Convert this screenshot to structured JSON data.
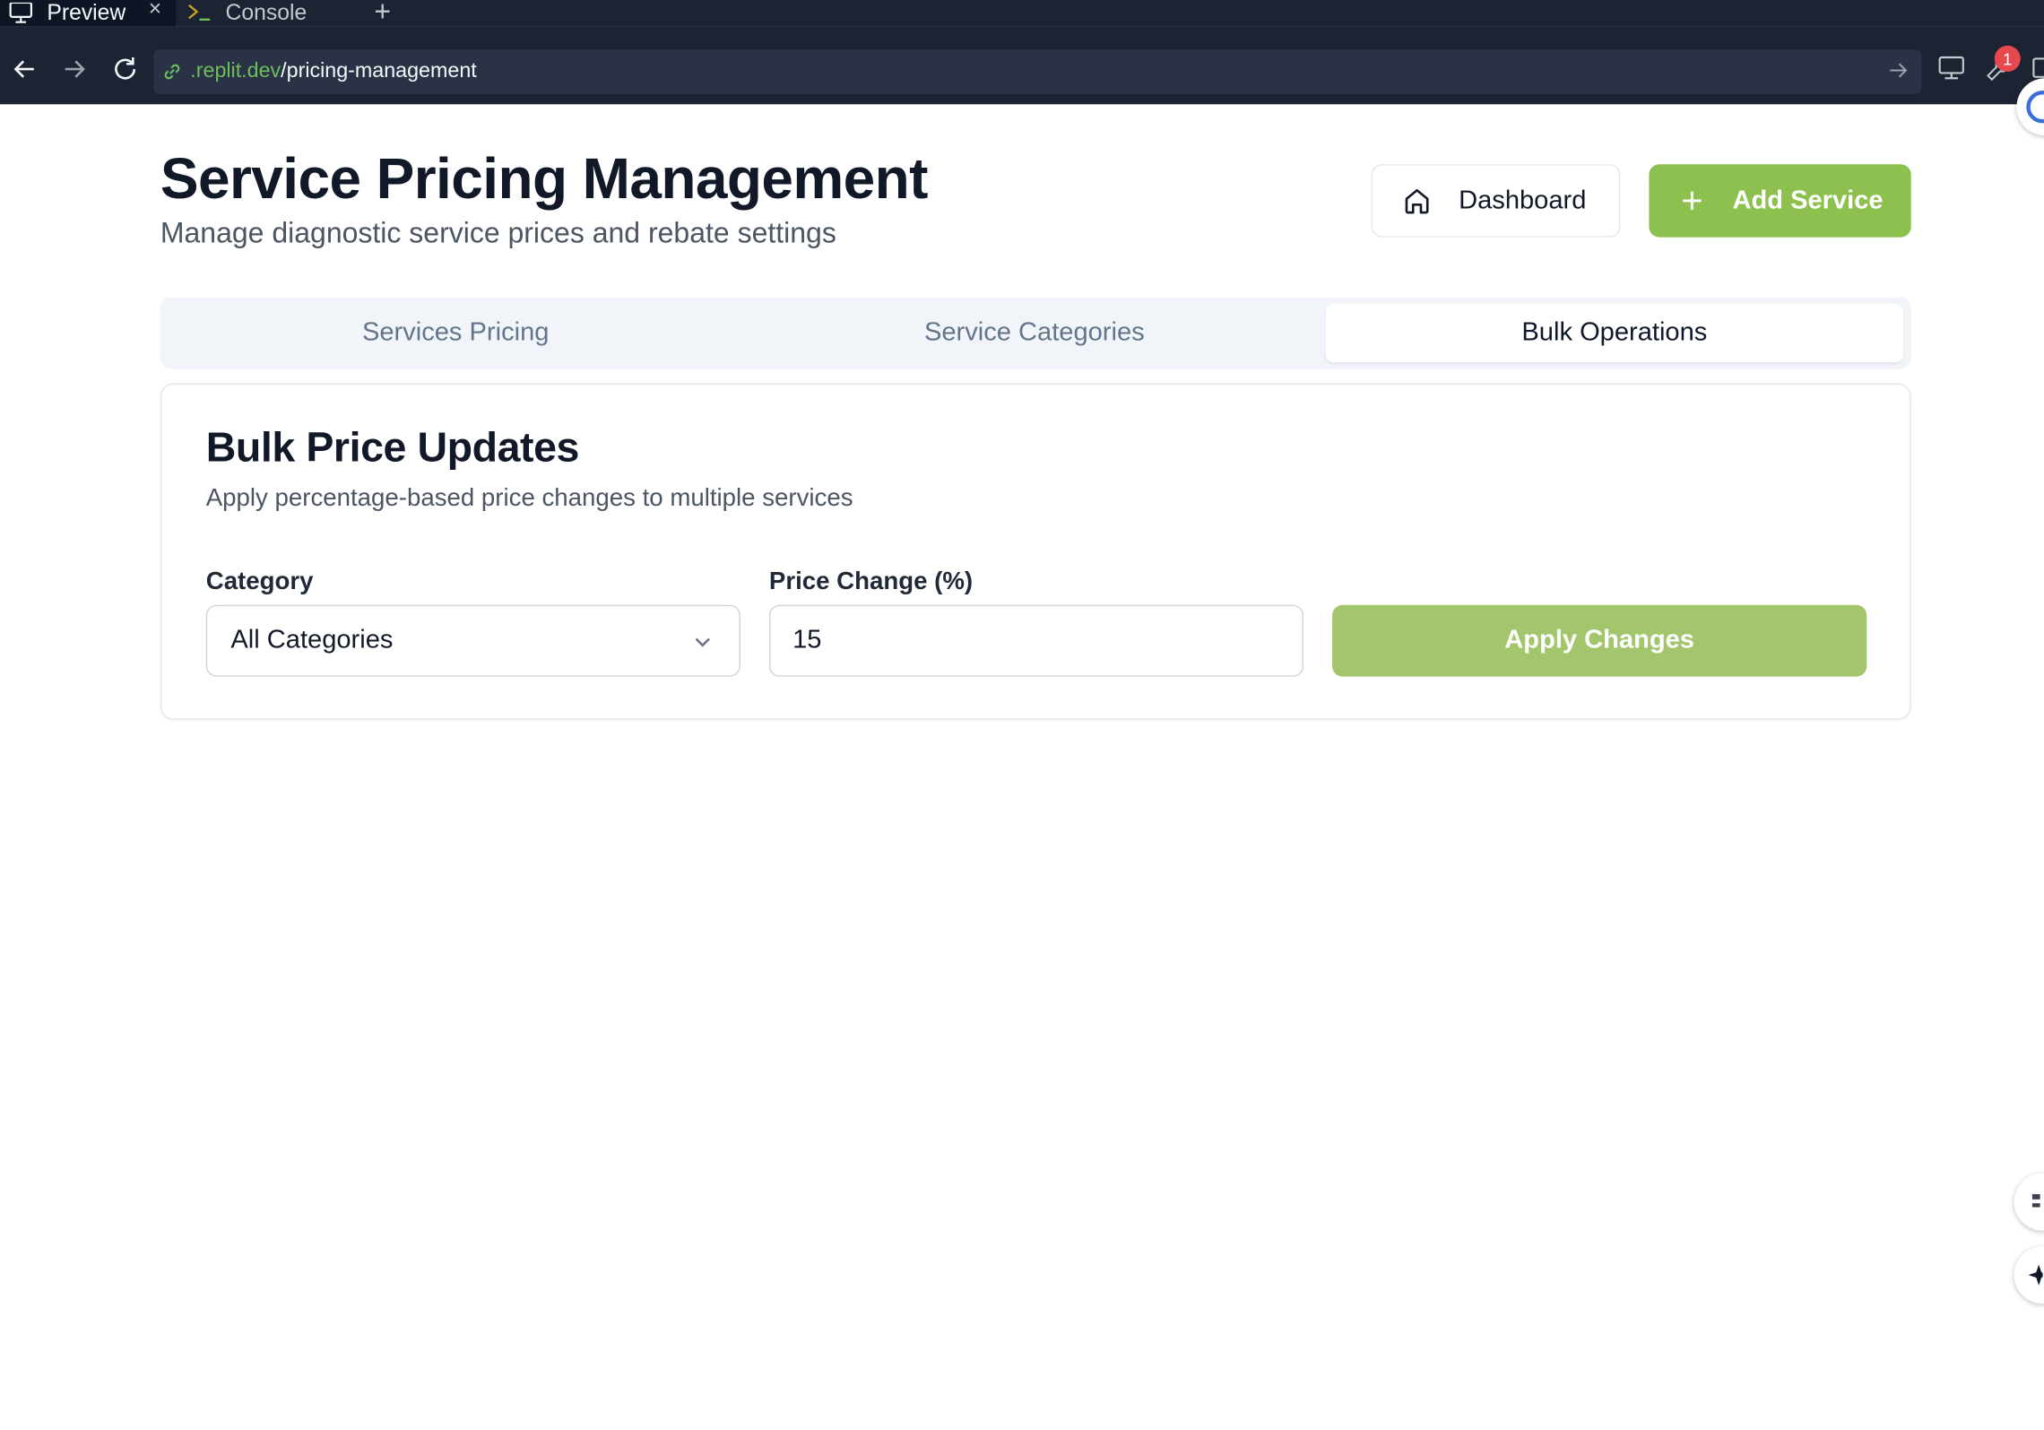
{
  "browser": {
    "tabs": [
      {
        "label": "Preview",
        "icon": "monitor-icon",
        "active": true
      },
      {
        "label": "Console",
        "icon": "terminal-icon",
        "active": false
      }
    ],
    "url": {
      "host": ".replit.dev",
      "path": "/pricing-management"
    },
    "notification_count": "1"
  },
  "header": {
    "title": "Service Pricing Management",
    "subtitle": "Manage diagnostic service prices and rebate settings",
    "dashboard_label": "Dashboard",
    "add_service_label": "Add Service"
  },
  "tabs": [
    {
      "label": "Services Pricing",
      "active": false
    },
    {
      "label": "Service Categories",
      "active": false
    },
    {
      "label": "Bulk Operations",
      "active": true
    }
  ],
  "bulk": {
    "title": "Bulk Price Updates",
    "description": "Apply percentage-based price changes to multiple services",
    "category_label": "Category",
    "category_value": "All Categories",
    "price_change_label": "Price Change (%)",
    "price_change_value": "15",
    "apply_label": "Apply Changes"
  },
  "colors": {
    "accent": "#8dc04e",
    "accent_muted": "#a3c56b",
    "chrome_bg": "#1c2333"
  }
}
